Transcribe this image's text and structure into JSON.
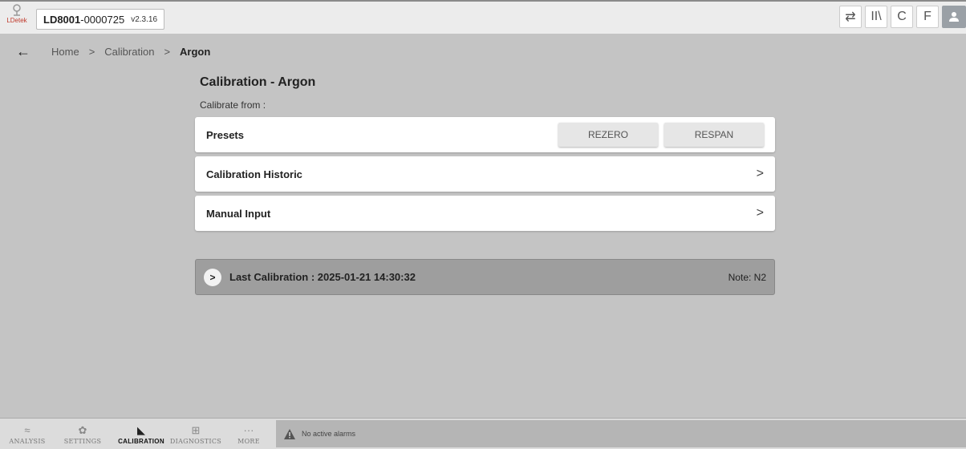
{
  "topbar": {
    "logo_text": "LDetek",
    "device_id_bold": "LD8001",
    "device_id_rest": "-0000725",
    "version": "v2.3.16",
    "actions": [
      {
        "icon": "swap-arrows-icon",
        "glyph": "⇄"
      },
      {
        "icon": "library-icon",
        "glyph": "II\\"
      },
      {
        "icon": "celsius-icon",
        "glyph": "C"
      },
      {
        "icon": "fahrenheit-icon",
        "glyph": "F"
      },
      {
        "icon": "user-icon",
        "glyph": ""
      }
    ]
  },
  "breadcrumb": {
    "back_glyph": "←",
    "items": [
      "Home",
      "Calibration",
      "Argon"
    ],
    "separator": ">"
  },
  "page": {
    "title": "Calibration - Argon",
    "subtitle": "Calibrate from :"
  },
  "cards": {
    "presets": {
      "label": "Presets",
      "rezero": "REZERO",
      "respan": "RESPAN"
    },
    "historic": {
      "label": "Calibration Historic",
      "chevron": ">"
    },
    "manual": {
      "label": "Manual Input",
      "chevron": ">"
    }
  },
  "last_calibration": {
    "expand_glyph": ">",
    "text": "Last Calibration : 2025-01-21 14:30:32",
    "note": "Note: N2"
  },
  "bottom_nav": {
    "items": [
      {
        "label": "ANALYSIS",
        "icon": "chart-icon",
        "glyph": "≈"
      },
      {
        "label": "SETTINGS",
        "icon": "gear-icon",
        "glyph": "✿"
      },
      {
        "label": "CALIBRATION",
        "icon": "set-square-icon",
        "glyph": "◣"
      },
      {
        "label": "DIAGNOSTICS",
        "icon": "plus-box-icon",
        "glyph": "⊞"
      },
      {
        "label": "MORE",
        "icon": "more-icon",
        "glyph": "···"
      }
    ],
    "active": "CALIBRATION"
  },
  "alarm": {
    "text": "No active alarms",
    "icon": "warning-icon"
  },
  "colors": {
    "background": "#c4c4c4",
    "topbar": "#ececec",
    "last_cal_bg": "#9e9e9e",
    "logo_red": "#c0392b"
  }
}
